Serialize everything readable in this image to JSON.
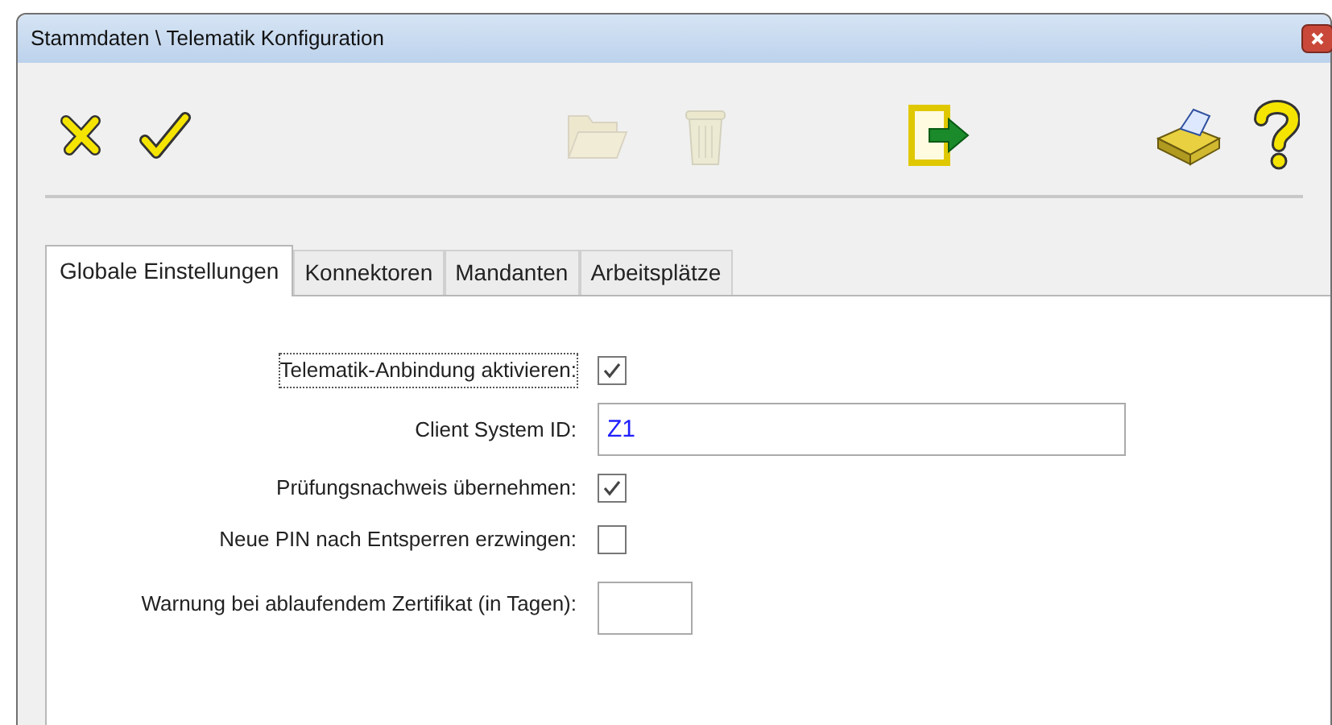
{
  "window": {
    "title": "Stammdaten \\ Telematik Konfiguration"
  },
  "toolbar": [
    {
      "kind": "cancel",
      "disabled": false
    },
    {
      "kind": "ok",
      "disabled": false
    },
    {
      "kind": "folder",
      "disabled": true
    },
    {
      "kind": "trash",
      "disabled": true
    },
    {
      "kind": "exit",
      "disabled": false
    },
    {
      "kind": "print",
      "disabled": false
    },
    {
      "kind": "help",
      "disabled": false
    }
  ],
  "tabs": [
    {
      "label": "Globale Einstellungen",
      "selected": true
    },
    {
      "label": "Konnektoren",
      "selected": false
    },
    {
      "label": "Mandanten",
      "selected": false
    },
    {
      "label": "Arbeitsplätze",
      "selected": false
    }
  ],
  "fields": [
    {
      "kind": "checkbox",
      "label": "Telematik-Anbindung aktivieren:",
      "checked": true,
      "focused": true
    },
    {
      "kind": "text",
      "label": "Client System ID:",
      "value": "Z1"
    },
    {
      "kind": "checkbox",
      "label": "Prüfungsnachweis übernehmen:",
      "checked": true,
      "focused": false
    },
    {
      "kind": "checkbox",
      "label": "Neue PIN nach Entsperren erzwingen:",
      "checked": false,
      "focused": false
    },
    {
      "kind": "short_text",
      "label": "Warnung bei ablaufendem Zertifikat (in Tagen):"
    }
  ]
}
